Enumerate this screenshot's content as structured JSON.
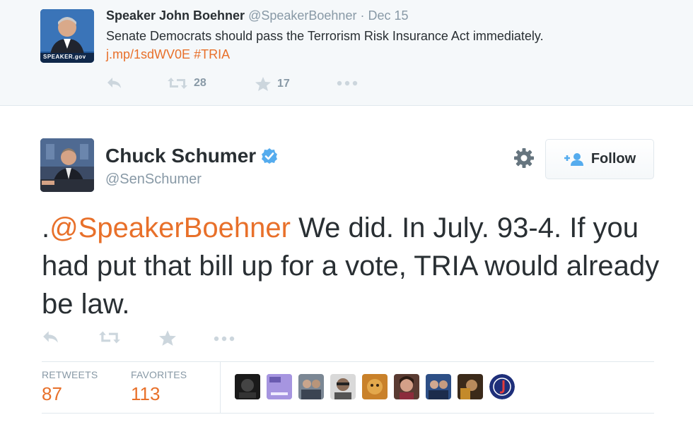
{
  "parent_tweet": {
    "name": "Speaker John Boehner",
    "handle": "@SpeakerBoehner",
    "separator": "·",
    "date": "Dec 15",
    "text": "Senate Democrats should pass the Terrorism Risk Insurance Act immediately.",
    "link": "j.mp/1sdWV0E",
    "hashtag": "#TRIA",
    "avatar_caption": "SPEAKER.gov",
    "retweets": "28",
    "favorites": "17"
  },
  "main_tweet": {
    "name": "Chuck Schumer",
    "handle": "@SenSchumer",
    "follow_label": "Follow",
    "text_prefix": ".",
    "mention": "@SpeakerBoehner",
    "text_rest": " We did. In July. 93-4. If you had put that bill up for a vote, TRIA would already be law.",
    "stats": {
      "retweets_label": "RETWEETS",
      "retweets_value": "87",
      "favorites_label": "FAVORITES",
      "favorites_value": "113"
    }
  },
  "icons": {
    "reply": "reply-icon",
    "retweet": "retweet-icon",
    "favorite": "star-icon",
    "more": "more-icon",
    "settings": "gear-icon",
    "verified": "verified-badge-icon",
    "follow": "add-user-icon"
  },
  "colors": {
    "link": "#e8702a",
    "muted": "#8899a6",
    "icon": "#ccd6dd",
    "verified": "#55acee",
    "parent_bg": "#f5f8fa"
  }
}
